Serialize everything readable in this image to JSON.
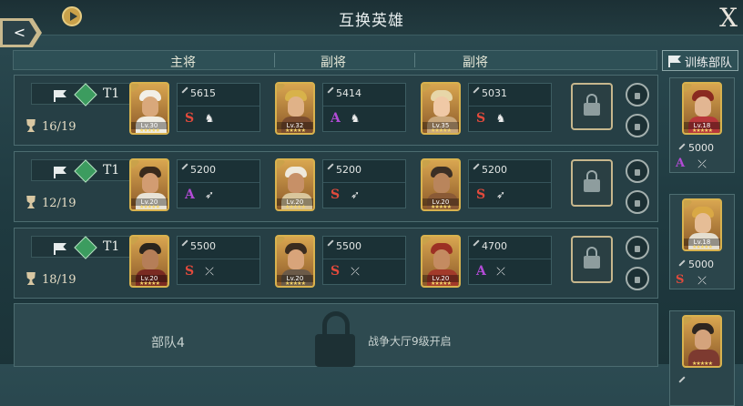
{
  "header": {
    "title": "互换英雄",
    "close": "X"
  },
  "columns": [
    "主将",
    "副将",
    "副将"
  ],
  "train_tab": "训练部队",
  "squads": [
    {
      "tier": "T1",
      "count": "16/19",
      "heroes": [
        {
          "power": "5615",
          "grade": "S",
          "grade_color": "#e14a3c",
          "type_icon": "horse",
          "lv": "Lv.30",
          "skin": "#d9a87b",
          "hair": "#f2efe8",
          "body": "#f0ede3"
        },
        {
          "power": "5414",
          "grade": "A",
          "grade_color": "#b24bd6",
          "type_icon": "horse",
          "lv": "Lv.32",
          "skin": "#e0b288",
          "hair": "#d8b24a",
          "body": "#7a4c2f"
        },
        {
          "power": "5031",
          "grade": "S",
          "grade_color": "#e14a3c",
          "type_icon": "horse",
          "lv": "Lv.35",
          "skin": "#f0c9a6",
          "hair": "#e7d6a8",
          "body": "#c9a77b"
        }
      ]
    },
    {
      "tier": "T1",
      "count": "12/19",
      "heroes": [
        {
          "power": "5200",
          "grade": "A",
          "grade_color": "#b24bd6",
          "type_icon": "spear",
          "lv": "Lv.20",
          "skin": "#d29c72",
          "hair": "#3a2a1c",
          "body": "#e8e3d6"
        },
        {
          "power": "5200",
          "grade": "S",
          "grade_color": "#e14a3c",
          "type_icon": "spear",
          "lv": "Lv.20",
          "skin": "#c79067",
          "hair": "#efe9dc",
          "body": "#d9c69c"
        },
        {
          "power": "5200",
          "grade": "S",
          "grade_color": "#e14a3c",
          "type_icon": "spear",
          "lv": "Lv.20",
          "skin": "#b9855c",
          "hair": "#3b2f25",
          "body": "#8a5a36"
        }
      ]
    },
    {
      "tier": "T1",
      "count": "18/19",
      "heroes": [
        {
          "power": "5500",
          "grade": "S",
          "grade_color": "#e14a3c",
          "type_icon": "bow",
          "lv": "Lv.20",
          "skin": "#b57e58",
          "hair": "#2a241d",
          "body": "#7a2a22"
        },
        {
          "power": "5500",
          "grade": "S",
          "grade_color": "#e14a3c",
          "type_icon": "bow",
          "lv": "Lv.20",
          "skin": "#d8a47a",
          "hair": "#3a2c1f",
          "body": "#6b5a48"
        },
        {
          "power": "4700",
          "grade": "A",
          "grade_color": "#b24bd6",
          "type_icon": "bow",
          "lv": "Lv.20",
          "skin": "#c48b61",
          "hair": "#9c3024",
          "body": "#a33a2a"
        }
      ]
    }
  ],
  "squad4": {
    "name": "部队4",
    "unlock": "战争大厅9级开启"
  },
  "training": [
    {
      "power": "5000",
      "grade": "A",
      "grade_color": "#b24bd6",
      "type_icon": "bow",
      "lv": "Lv.18",
      "skin": "#e2b692",
      "hair": "#8a2a20",
      "body": "#b8373a"
    },
    {
      "power": "5000",
      "grade": "S",
      "grade_color": "#e14a3c",
      "type_icon": "bow",
      "lv": "Lv.18",
      "skin": "#e6bd96",
      "hair": "#d9a845",
      "body": "#e4ded0"
    },
    {
      "power": "",
      "grade": "",
      "grade_color": "#e14a3c",
      "type_icon": "",
      "lv": "",
      "skin": "#d4a37c",
      "hair": "#2e2620",
      "body": "#7d3a30"
    }
  ],
  "icons": {
    "horse": "♞",
    "spear": "➶",
    "bow": "⤫"
  }
}
